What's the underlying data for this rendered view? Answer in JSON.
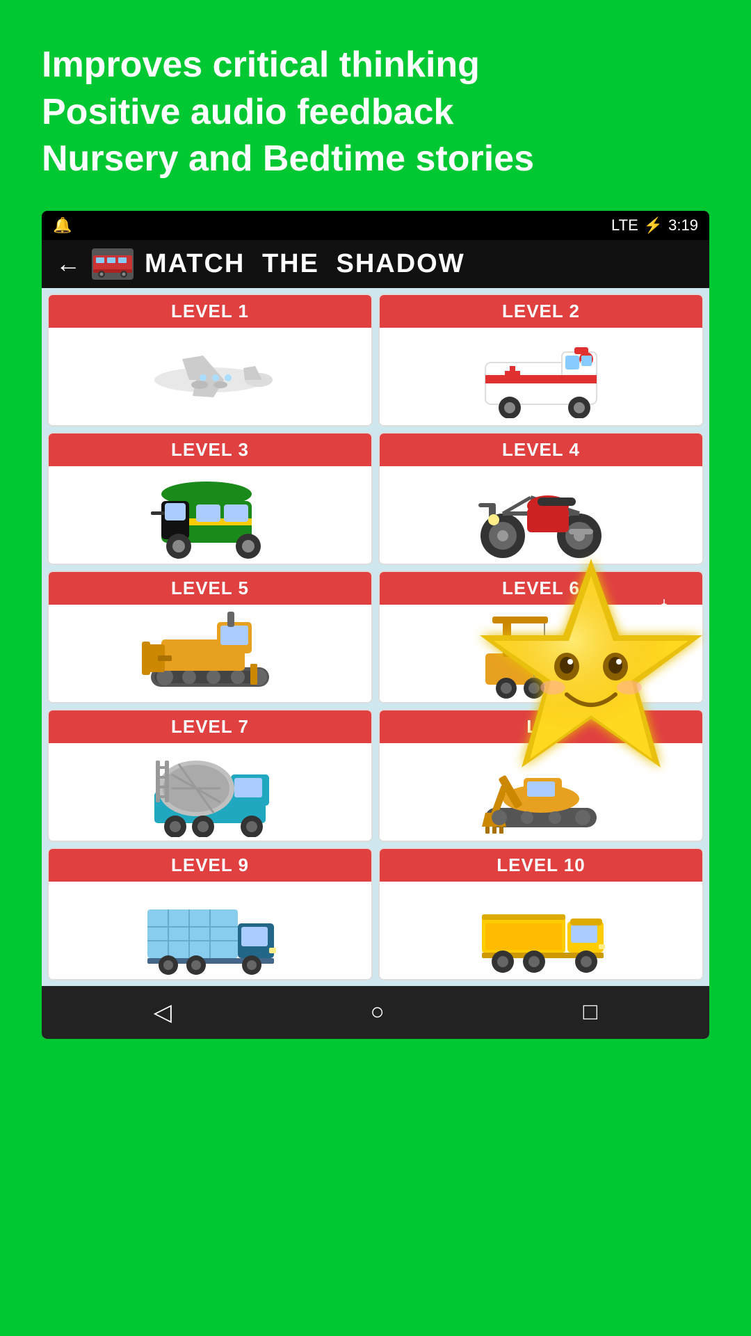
{
  "top_text": {
    "line1": "Improves critical thinking",
    "line2": "Positive audio feedback",
    "line3": "Nursery and Bedtime stories"
  },
  "status_bar": {
    "signal": "LTE",
    "battery": "🔋",
    "time": "3:19"
  },
  "header": {
    "title": "MAtch THE SHADOW",
    "back_label": "←"
  },
  "levels": [
    {
      "id": 1,
      "label": "LEVEL 1",
      "vehicle": "airplane"
    },
    {
      "id": 2,
      "label": "LEVEL 2",
      "vehicle": "ambulance"
    },
    {
      "id": 3,
      "label": "LEVEL 3",
      "vehicle": "autorickshaw"
    },
    {
      "id": 4,
      "label": "LEVEL 4",
      "vehicle": "motorcycle"
    },
    {
      "id": 5,
      "label": "LEVEL 5",
      "vehicle": "bulldozer"
    },
    {
      "id": 6,
      "label": "LEVEL 6",
      "vehicle": "crane"
    },
    {
      "id": 7,
      "label": "LEVEL 7",
      "vehicle": "cement-mixer"
    },
    {
      "id": 8,
      "label": "L...",
      "vehicle": "excavator"
    },
    {
      "id": 9,
      "label": "LEVEL 9",
      "vehicle": "cargo-truck"
    },
    {
      "id": 10,
      "label": "LEVEL 10",
      "vehicle": "dump-truck"
    }
  ],
  "nav": {
    "back": "◁",
    "home": "○",
    "square": "□"
  },
  "colors": {
    "background": "#00c832",
    "header_bg": "#111111",
    "level_label_bg": "#e04040",
    "phone_bg": "#cfe8f0"
  }
}
